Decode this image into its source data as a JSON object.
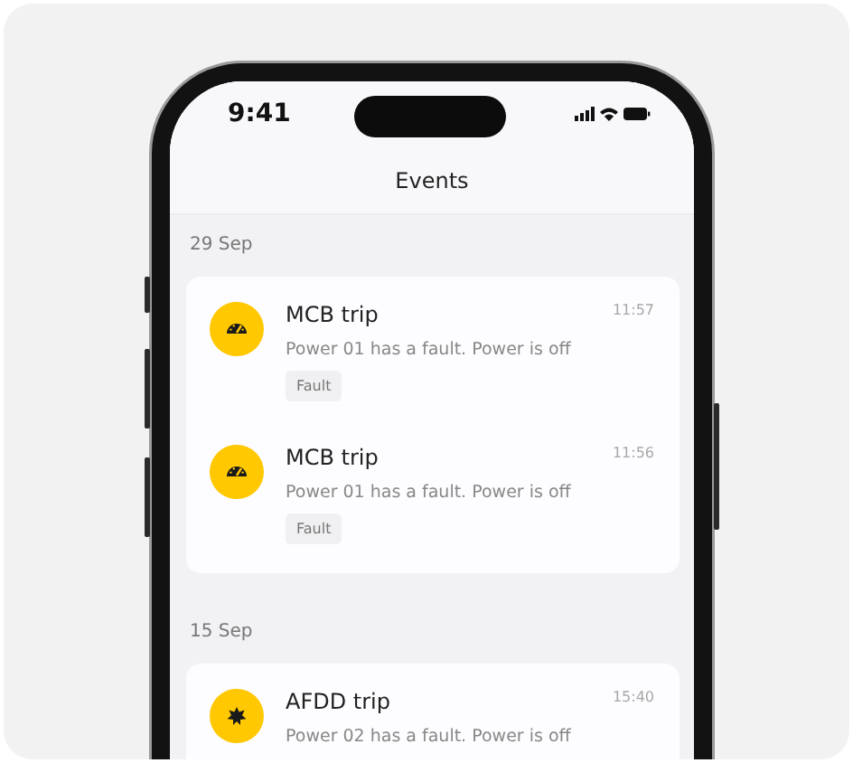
{
  "status_bar": {
    "time": "9:41"
  },
  "header": {
    "title": "Events"
  },
  "sections": [
    {
      "date": "29 Sep",
      "events": [
        {
          "kind": "gauge",
          "title": "MCB trip",
          "time": "11:57",
          "message": "Power 01 has a fault. Power is off",
          "tag": "Fault"
        },
        {
          "kind": "gauge",
          "title": "MCB trip",
          "time": "11:56",
          "message": "Power 01 has a fault. Power is off",
          "tag": "Fault"
        }
      ]
    },
    {
      "date": "15 Sep",
      "events": [
        {
          "kind": "burst",
          "title": "AFDD trip",
          "time": "15:40",
          "message": "Power 02 has a fault. Power is off"
        }
      ]
    }
  ]
}
